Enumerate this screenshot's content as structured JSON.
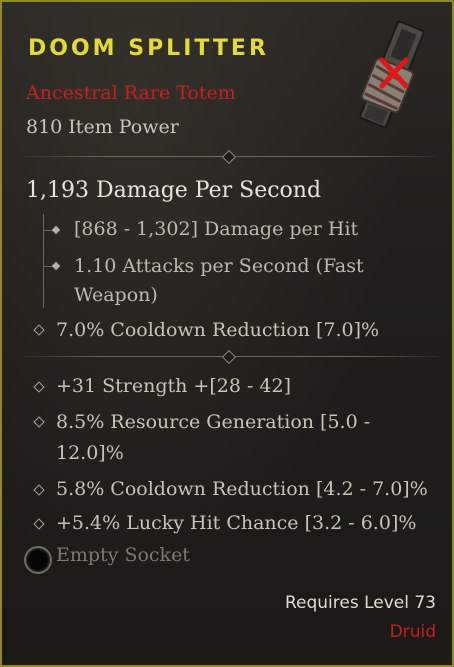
{
  "item": {
    "name": "Doom Splitter",
    "type": "Ancestral Rare Totem",
    "item_power": "810 Item Power",
    "icon": "totem-icon"
  },
  "weapon_stats": {
    "dps": "1,193 Damage Per Second",
    "damage_per_hit": "[868 - 1,302] Damage per Hit",
    "attacks_per_second_line1": "1.10 Attacks per Second (Fast",
    "attacks_per_second_line2": "Weapon)"
  },
  "implicit": {
    "cooldown": "7.0% Cooldown Reduction [7.0]%"
  },
  "affixes": {
    "strength": "+31 Strength +[28 - 42]",
    "resource_line1": "8.5% Resource Generation [5.0 -",
    "resource_line2": "12.0]%",
    "cooldown": "5.8% Cooldown Reduction [4.2 - 7.0]%",
    "lucky_hit": "+5.4% Lucky Hit Chance [3.2 - 6.0]%"
  },
  "socket": {
    "label": "Empty Socket"
  },
  "requirements": {
    "level": "Requires Level 73",
    "class": "Druid"
  },
  "colors": {
    "border": "#8f8a22",
    "title": "#e4d93a",
    "rare_red": "#c81f1f"
  }
}
